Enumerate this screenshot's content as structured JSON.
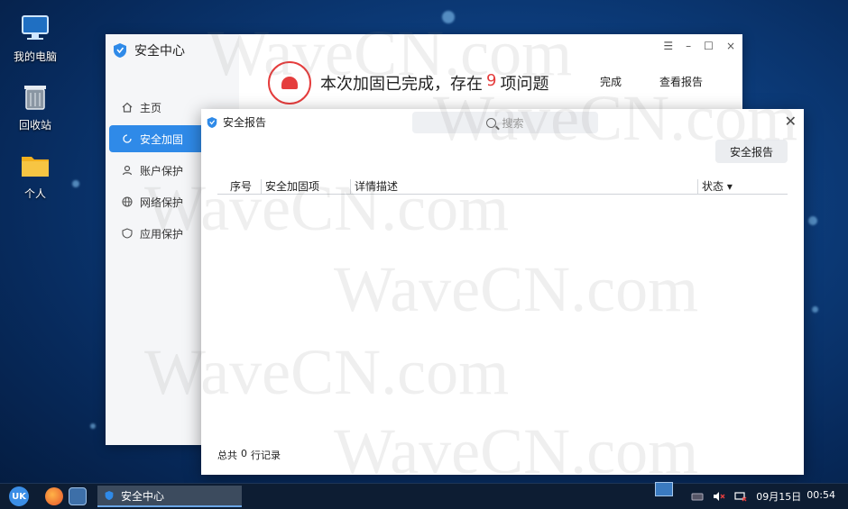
{
  "desktop": {
    "icons": [
      {
        "label": "我的电脑",
        "icon": "computer-icon"
      },
      {
        "label": "回收站",
        "icon": "recycle-bin-icon"
      },
      {
        "label": "个人",
        "icon": "folder-icon"
      }
    ]
  },
  "main_window": {
    "title": "安全中心",
    "controls": {
      "menu": "☰",
      "minimize": "–",
      "maximize": "☐",
      "close": "×"
    },
    "nav": [
      {
        "label": "主页",
        "icon": "home-icon"
      },
      {
        "label": "安全加固",
        "icon": "reinforce-icon",
        "active": true
      },
      {
        "label": "账户保护",
        "icon": "user-icon"
      },
      {
        "label": "网络保护",
        "icon": "globe-icon"
      },
      {
        "label": "应用保护",
        "icon": "shield-app-icon"
      }
    ],
    "header": {
      "prefix": "本次加固已完成，存在",
      "count": "9",
      "suffix": "项问题",
      "done_button": "完成",
      "view_report_button": "查看报告",
      "alert_color": "#e53d3d"
    }
  },
  "report_dialog": {
    "title": "安全报告",
    "search_placeholder": "搜索",
    "report_button": "安全报告",
    "columns": [
      "序号",
      "安全加固项",
      "详情描述",
      "状态 ▾"
    ],
    "rows": [],
    "footer": {
      "prefix": "总共",
      "count": "0",
      "suffix": "行记录"
    }
  },
  "watermark": "WaveCN.com",
  "taskbar": {
    "start_label": "UK",
    "active_task": "安全中心",
    "clock": {
      "date": "09月15日",
      "time": "00:54"
    }
  },
  "colors": {
    "accent": "#2f8ae8",
    "alert": "#e53d3d",
    "taskbar": "#0d1d33"
  }
}
